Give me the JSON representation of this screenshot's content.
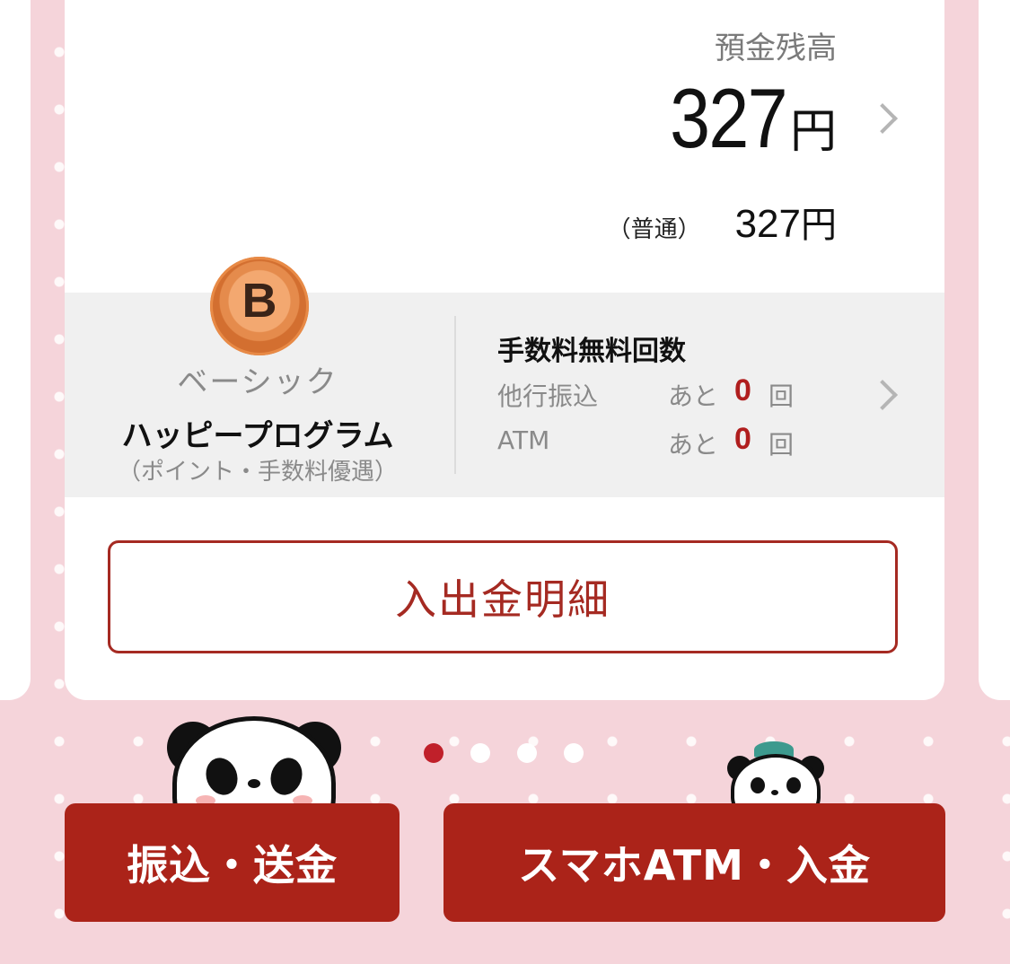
{
  "balance": {
    "label": "預金残高",
    "amount": "327",
    "currency": "円"
  },
  "sub_account": {
    "kind": "（普通）",
    "amount": "327",
    "currency": "円"
  },
  "program": {
    "badge_letter": "B",
    "rank": "ベーシック",
    "name": "ハッピープログラム",
    "description": "（ポイント・手数料優遇）"
  },
  "fees": {
    "title": "手数料無料回数",
    "rows": [
      {
        "label": "他行振込",
        "prefix": "あと",
        "count": "0",
        "unit": "回"
      },
      {
        "label": "ATM",
        "prefix": "あと",
        "count": "0",
        "unit": "回"
      }
    ]
  },
  "history_button": "入出金明細",
  "pagination": {
    "total": 4,
    "active": 1
  },
  "actions": {
    "transfer": "振込・送金",
    "atm": "スマホATM・入金"
  },
  "colors": {
    "accent": "#ab2319",
    "background": "#f5d4da",
    "count": "#b01e1e"
  },
  "icons": [
    "chevron-right-icon",
    "rank-badge-icon",
    "panda-icon"
  ]
}
